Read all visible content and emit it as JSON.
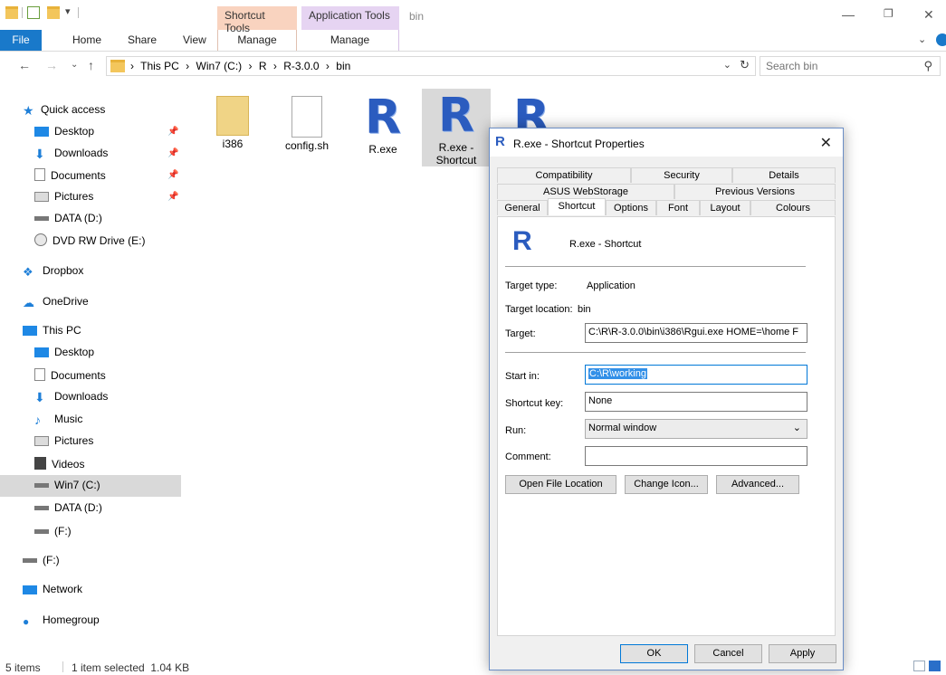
{
  "window": {
    "title": "bin",
    "context_tabs": [
      "Shortcut Tools",
      "Application Tools"
    ]
  },
  "ribbon": {
    "file": "File",
    "tabs": [
      "Home",
      "Share",
      "View"
    ],
    "manage1": "Manage",
    "manage2": "Manage"
  },
  "address": {
    "crumbs": [
      "This PC",
      "Win7 (C:)",
      "R",
      "R-3.0.0",
      "bin"
    ],
    "search_placeholder": "Search bin"
  },
  "nav": {
    "quick_access": "Quick access",
    "quick_items": [
      "Desktop",
      "Downloads",
      "Documents",
      "Pictures"
    ],
    "drives_top": [
      "DATA (D:)",
      "DVD RW Drive (E:)"
    ],
    "dropbox": "Dropbox",
    "onedrive": "OneDrive",
    "this_pc": "This PC",
    "pc_items": [
      "Desktop",
      "Documents",
      "Downloads",
      "Music",
      "Pictures",
      "Videos",
      "Win7 (C:)",
      "DATA (D:)",
      "(F:)"
    ],
    "f_drive": "(F:)",
    "network": "Network",
    "homegroup": "Homegroup"
  },
  "files": [
    {
      "name": "i386"
    },
    {
      "name": "config.sh"
    },
    {
      "name": "R.exe"
    },
    {
      "name": "R.exe - Shortcut"
    },
    {
      "name": ""
    }
  ],
  "status": {
    "items": "5 items",
    "selected": "1 item selected  1.04 KB"
  },
  "dialog": {
    "title": "R.exe - Shortcut Properties",
    "tabs_row1": [
      "Compatibility",
      "Security",
      "Details"
    ],
    "tabs_row2": [
      "ASUS WebStorage",
      "Previous Versions"
    ],
    "tabs_row3": [
      "General",
      "Shortcut",
      "Options",
      "Font",
      "Layout",
      "Colours"
    ],
    "shortcut_name": "R.exe - Shortcut",
    "target_type_label": "Target type:",
    "target_type_value": "Application",
    "target_location_label": "Target location:",
    "target_location_value": "bin",
    "target_label": "Target:",
    "target_value": "C:\\R\\R-3.0.0\\bin\\i386\\Rgui.exe HOME=\\home F",
    "start_in_label": "Start in:",
    "start_in_value": "C:\\R\\working",
    "shortcut_key_label": "Shortcut key:",
    "shortcut_key_value": "None",
    "run_label": "Run:",
    "run_value": "Normal window",
    "comment_label": "Comment:",
    "comment_value": "",
    "btn_open_location": "Open File Location",
    "btn_change_icon": "Change Icon...",
    "btn_advanced": "Advanced...",
    "btn_ok": "OK",
    "btn_cancel": "Cancel",
    "btn_apply": "Apply"
  }
}
